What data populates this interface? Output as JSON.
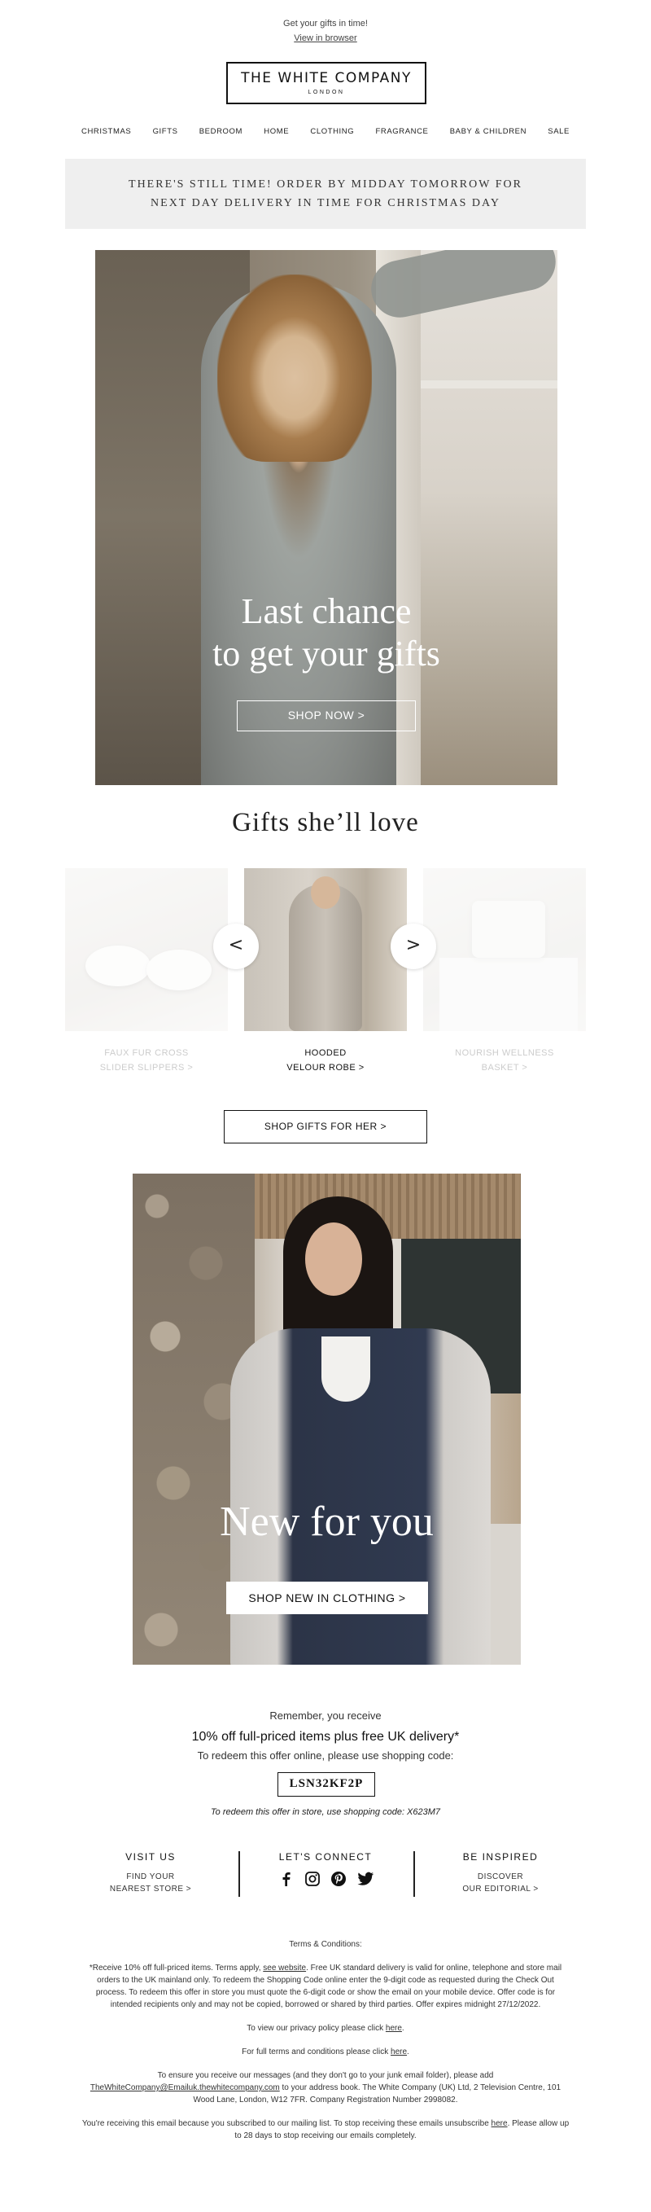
{
  "preheader": {
    "text": "Get your gifts in time!",
    "view_in_browser": "View in browser"
  },
  "logo": {
    "name": "THE WHITE COMPANY",
    "sub": "LONDON"
  },
  "nav": {
    "items": [
      "CHRISTMAS",
      "GIFTS",
      "BEDROOM",
      "HOME",
      "CLOTHING",
      "FRAGRANCE",
      "BABY & CHILDREN",
      "SALE"
    ]
  },
  "banner": {
    "line1": "THERE'S STILL TIME! ORDER BY MIDDAY TOMORROW FOR",
    "line2": "NEXT DAY DELIVERY IN TIME FOR CHRISTMAS DAY"
  },
  "hero": {
    "title_line1": "Last chance",
    "title_line2": "to get your gifts",
    "button": "SHOP NOW >"
  },
  "gifts": {
    "title": "Gifts she’ll love",
    "prev": "<",
    "next": ">",
    "items": [
      {
        "line1": "FAUX FUR CROSS",
        "line2": "SLIDER SLIPPERS >"
      },
      {
        "line1": "HOODED",
        "line2": "VELOUR ROBE >"
      },
      {
        "line1": "NOURISH WELLNESS",
        "line2": "BASKET >"
      }
    ],
    "button": "SHOP GIFTS FOR HER >"
  },
  "new_for_you": {
    "title": "New for you",
    "button": "SHOP NEW IN CLOTHING >"
  },
  "offer": {
    "remember": "Remember, you receive",
    "headline": "10% off full-priced items plus free UK delivery*",
    "redeem_online": "To redeem this offer online, please use shopping code:",
    "code": "LSN32KF2P",
    "redeem_store": "To redeem this offer in store, use shopping code: X623M7"
  },
  "footer": {
    "visit": {
      "heading": "VISIT US",
      "line1": "FIND YOUR",
      "line2": "NEAREST STORE >"
    },
    "connect": {
      "heading": "LET'S CONNECT",
      "icons": [
        "facebook-icon",
        "instagram-icon",
        "pinterest-icon",
        "twitter-icon"
      ]
    },
    "inspired": {
      "heading": "BE INSPIRED",
      "line1": "DISCOVER",
      "line2": "OUR EDITORIAL >"
    }
  },
  "legal": {
    "terms_heading": "Terms & Conditions:",
    "terms_pre": "*Receive 10% off full-priced items. Terms apply, ",
    "terms_link": "see website",
    "terms_post": ". Free UK standard delivery is valid for online, telephone and store mail orders to the UK mainland only. To redeem the Shopping Code online enter the 9-digit code as requested during the Check Out process. To redeem this offer in store you must quote the 6-digit code or show the email on your mobile device. Offer code is for intended recipients only and may not be copied, borrowed or shared by third parties. Offer expires midnight 27/12/2022.",
    "privacy_pre": "To view our privacy policy please click ",
    "privacy_link": "here",
    "full_terms_pre": "For full terms and conditions please click ",
    "full_terms_link": "here",
    "address_pre": "To ensure you receive our messages (and they don't go to your junk email folder), please add ",
    "address_email": "TheWhiteCompany@Emailuk.thewhitecompany.com",
    "address_post": " to your address book. The White Company (UK) Ltd, 2 Television Centre, 101 Wood Lane, London, W12 7FR. Company Registration Number 2998082.",
    "unsub_pre": "You're receiving this email because you subscribed to our mailing list. To stop receiving these emails unsubscribe ",
    "unsub_link": "here",
    "unsub_post": ". Please allow up to 28 days to stop receiving our emails completely.",
    "period": "."
  }
}
